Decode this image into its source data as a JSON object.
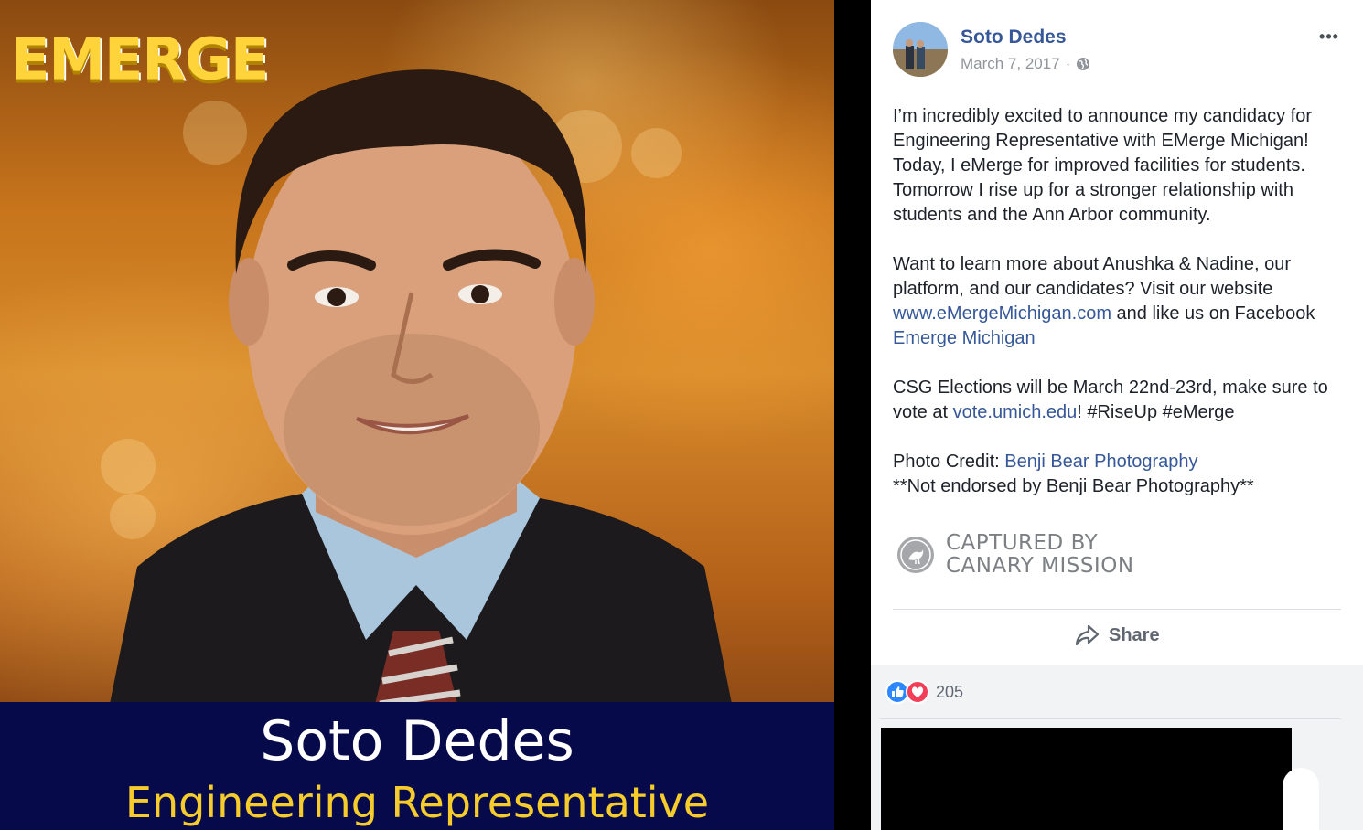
{
  "photo": {
    "logo_text": "EMERGE",
    "band_name": "Soto Dedes",
    "band_role": "Engineering Representative"
  },
  "post": {
    "author": "Soto Dedes",
    "date": "March 7, 2017",
    "separator": "·",
    "privacy_icon": "globe-icon",
    "more_label": "•••",
    "paragraphs": {
      "p1": "I’m incredibly excited to announce my candidacy for Engineering Representative with EMerge Michigan! Today, I eMerge for improved facilities for students. Tomorrow I rise up for a stronger relationship with students and the Ann Arbor community.",
      "p2_text1": "Want to learn more about Anushka & Nadine, our platform, and our candidates? Visit our website ",
      "p2_link1": "www.eMergeMichigan.com",
      "p2_text2": " and like us on Facebook ",
      "p2_link2": "Emerge Michigan",
      "p3_text1": "CSG Elections will be March 22nd-23rd, make sure to vote at ",
      "p3_link1": "vote.umich.edu",
      "p3_text2": "! #RiseUp #eMerge",
      "p4_text1": "Photo Credit: ",
      "p4_link1": "Benji Bear Photography",
      "p4_line2": "**Not endorsed by Benji Bear Photography**"
    },
    "watermark": {
      "line1": "CAPTURED BY",
      "line2": "CANARY MISSION"
    },
    "share_label": "Share",
    "reactions": {
      "icons": [
        "like-icon",
        "love-icon"
      ],
      "count": "205"
    }
  },
  "colors": {
    "link": "#365899",
    "text": "#1d2129",
    "meta": "#90949c",
    "band_bg": "#070a4a",
    "band_role": "#f6cc2c",
    "logo": "#ffd43b"
  }
}
